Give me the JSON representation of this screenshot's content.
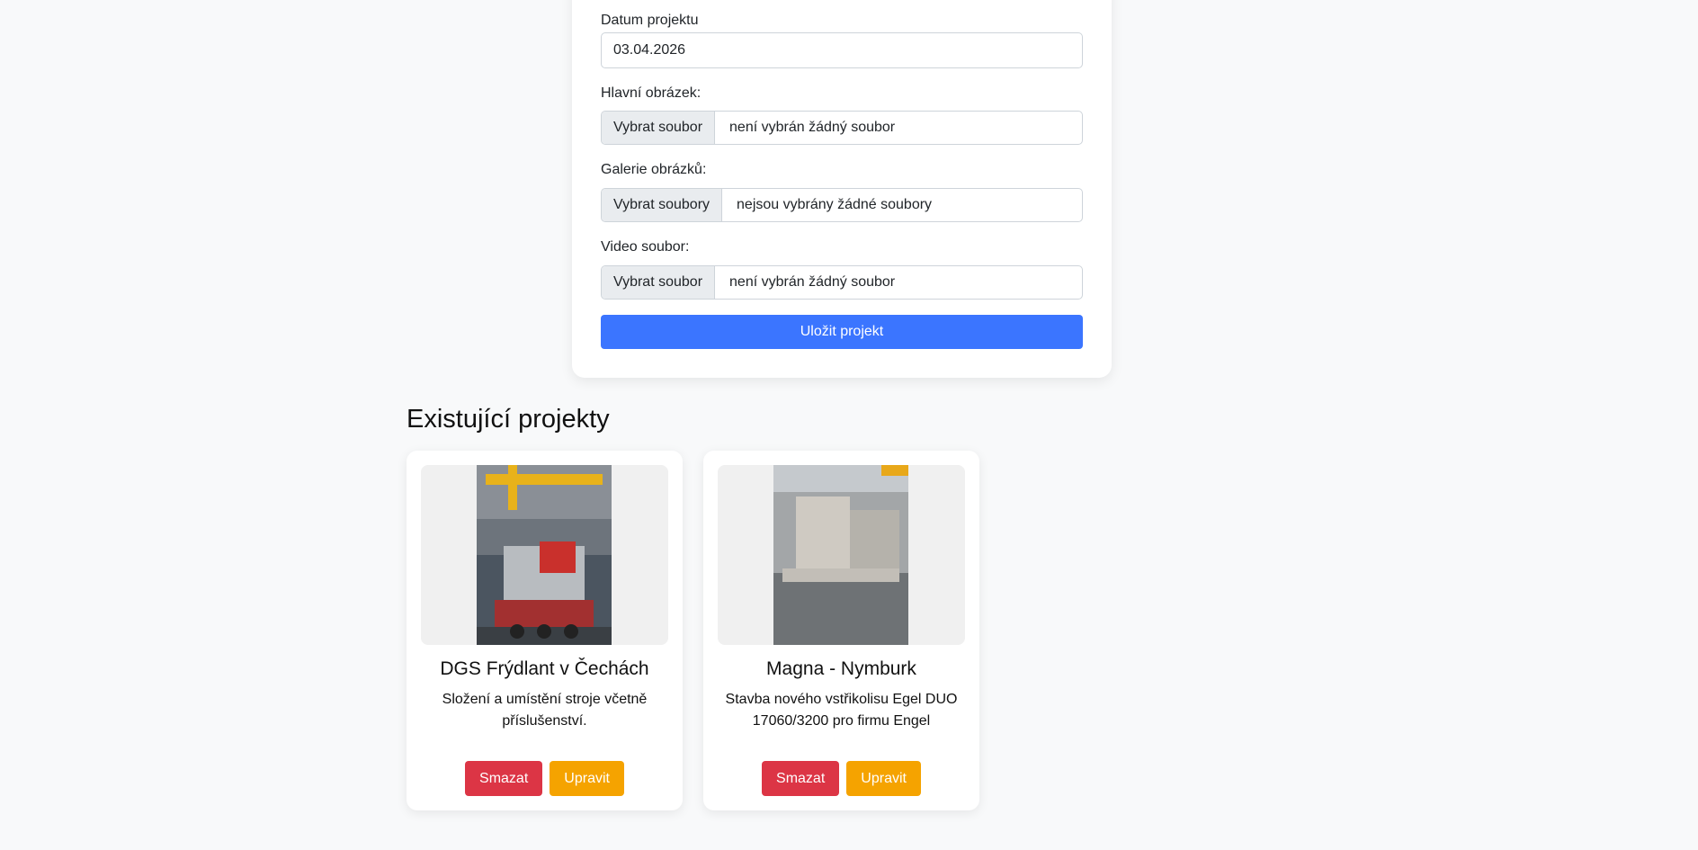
{
  "form": {
    "date_label": "Datum projektu",
    "date_value": "03.04.2026",
    "main_image_label": "Hlavní obrázek:",
    "main_image_button": "Vybrat soubor",
    "main_image_status": "není vybrán žádný soubor",
    "gallery_label": "Galerie obrázků:",
    "gallery_button": "Vybrat soubory",
    "gallery_status": "nejsou vybrány žádné soubory",
    "video_label": "Video soubor:",
    "video_button": "Vybrat soubor",
    "video_status": "není vybrán žádný soubor",
    "save_button": "Uložit projekt"
  },
  "projects_section": {
    "title": "Existující projekty",
    "projects": [
      {
        "title": "DGS Frýdlant v Čechách",
        "description": "Složení a umístění stroje včetně příslušenství.",
        "delete_label": "Smazat",
        "edit_label": "Upravit"
      },
      {
        "title": "Magna - Nymburk",
        "description": "Stavba nového vstřikolisu Egel DUO 17060/3200 pro firmu Engel",
        "delete_label": "Smazat",
        "edit_label": "Upravit"
      }
    ]
  },
  "colors": {
    "primary": "#3b75ff",
    "danger": "#dc3545",
    "warning": "#f5a300",
    "background": "#f8f9fa"
  }
}
